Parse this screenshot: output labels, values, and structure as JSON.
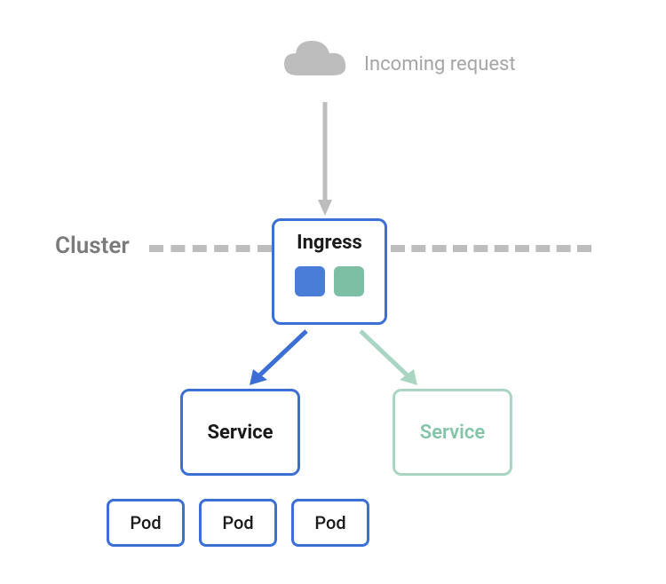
{
  "incoming_label": "Incoming request",
  "cluster_label": "Cluster",
  "ingress": {
    "title": "Ingress"
  },
  "services": {
    "blue": "Service",
    "green": "Service"
  },
  "pods": [
    "Pod",
    "Pod",
    "Pod"
  ],
  "colors": {
    "blue": "#3b6fd6",
    "green": "#7cbfa4",
    "gray": "#bdbdbd"
  }
}
